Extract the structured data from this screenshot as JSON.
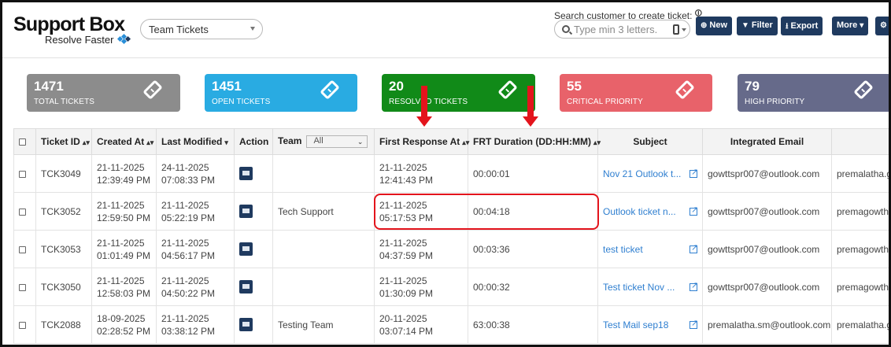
{
  "brand": {
    "title": "Support Box",
    "subtitle": "Resolve Faster"
  },
  "team_select": {
    "value": "Team Tickets"
  },
  "search": {
    "label": "Search customer to create ticket:",
    "placeholder": "Type min 3 letters."
  },
  "toolbar": {
    "new_label": "New",
    "filter_label": "Filter",
    "export_label": "Export",
    "more_label": "More"
  },
  "cards": [
    {
      "count": "1471",
      "label": "TOTAL TICKETS",
      "color": "#8c8c8c"
    },
    {
      "count": "1451",
      "label": "OPEN TICKETS",
      "color": "#29abe2"
    },
    {
      "count": "20",
      "label": "RESOLVED TICKETS",
      "color": "#118a18"
    },
    {
      "count": "55",
      "label": "CRITICAL PRIORITY",
      "color": "#e8626a"
    },
    {
      "count": "79",
      "label": "HIGH PRIORITY",
      "color": "#666a8a"
    }
  ],
  "table": {
    "headers": {
      "ticket_id": "Ticket ID",
      "created_at": "Created At",
      "last_modified": "Last Modified",
      "action": "Action",
      "team": "Team",
      "team_filter": "All",
      "first_response": "First Response At",
      "frt_duration": "FRT Duration (DD:HH:MM)",
      "subject": "Subject",
      "integrated_email": "Integrated Email"
    },
    "rows": [
      {
        "id": "TCK3049",
        "created_date": "21-11-2025",
        "created_time": "12:39:49 PM",
        "modified_date": "24-11-2025",
        "modified_time": "07:08:33 PM",
        "team": "",
        "fr_date": "21-11-2025",
        "fr_time": "12:41:43 PM",
        "frt": "00:00:01",
        "subject": "Nov 21 Outlook t...",
        "email": "gowttspr007@outlook.com",
        "customer": "premalatha.g"
      },
      {
        "id": "TCK3052",
        "created_date": "21-11-2025",
        "created_time": "12:59:50 PM",
        "modified_date": "21-11-2025",
        "modified_time": "05:22:19 PM",
        "team": "Tech Support",
        "fr_date": "21-11-2025",
        "fr_time": "05:17:53 PM",
        "frt": "00:04:18",
        "subject": "Outlook ticket n...",
        "email": "gowttspr007@outlook.com",
        "customer": "premagowtha"
      },
      {
        "id": "TCK3053",
        "created_date": "21-11-2025",
        "created_time": "01:01:49 PM",
        "modified_date": "21-11-2025",
        "modified_time": "04:56:17 PM",
        "team": "",
        "fr_date": "21-11-2025",
        "fr_time": "04:37:59 PM",
        "frt": "00:03:36",
        "subject": "test ticket",
        "email": "gowttspr007@outlook.com",
        "customer": "premagowtha"
      },
      {
        "id": "TCK3050",
        "created_date": "21-11-2025",
        "created_time": "12:58:03 PM",
        "modified_date": "21-11-2025",
        "modified_time": "04:50:22 PM",
        "team": "",
        "fr_date": "21-11-2025",
        "fr_time": "01:30:09 PM",
        "frt": "00:00:32",
        "subject": "Test ticket Nov ...",
        "email": "gowttspr007@outlook.com",
        "customer": "premagowtha"
      },
      {
        "id": "TCK2088",
        "created_date": "18-09-2025",
        "created_time": "02:28:52 PM",
        "modified_date": "21-11-2025",
        "modified_time": "03:38:12 PM",
        "team": "Testing Team",
        "fr_date": "20-11-2025",
        "fr_time": "03:07:14 PM",
        "frt": "63:00:38",
        "subject": "Test Mail sep18",
        "email": "premalatha.sm@outlook.com",
        "customer": "premalatha.g"
      }
    ]
  },
  "annotation_color": "#e3141c"
}
